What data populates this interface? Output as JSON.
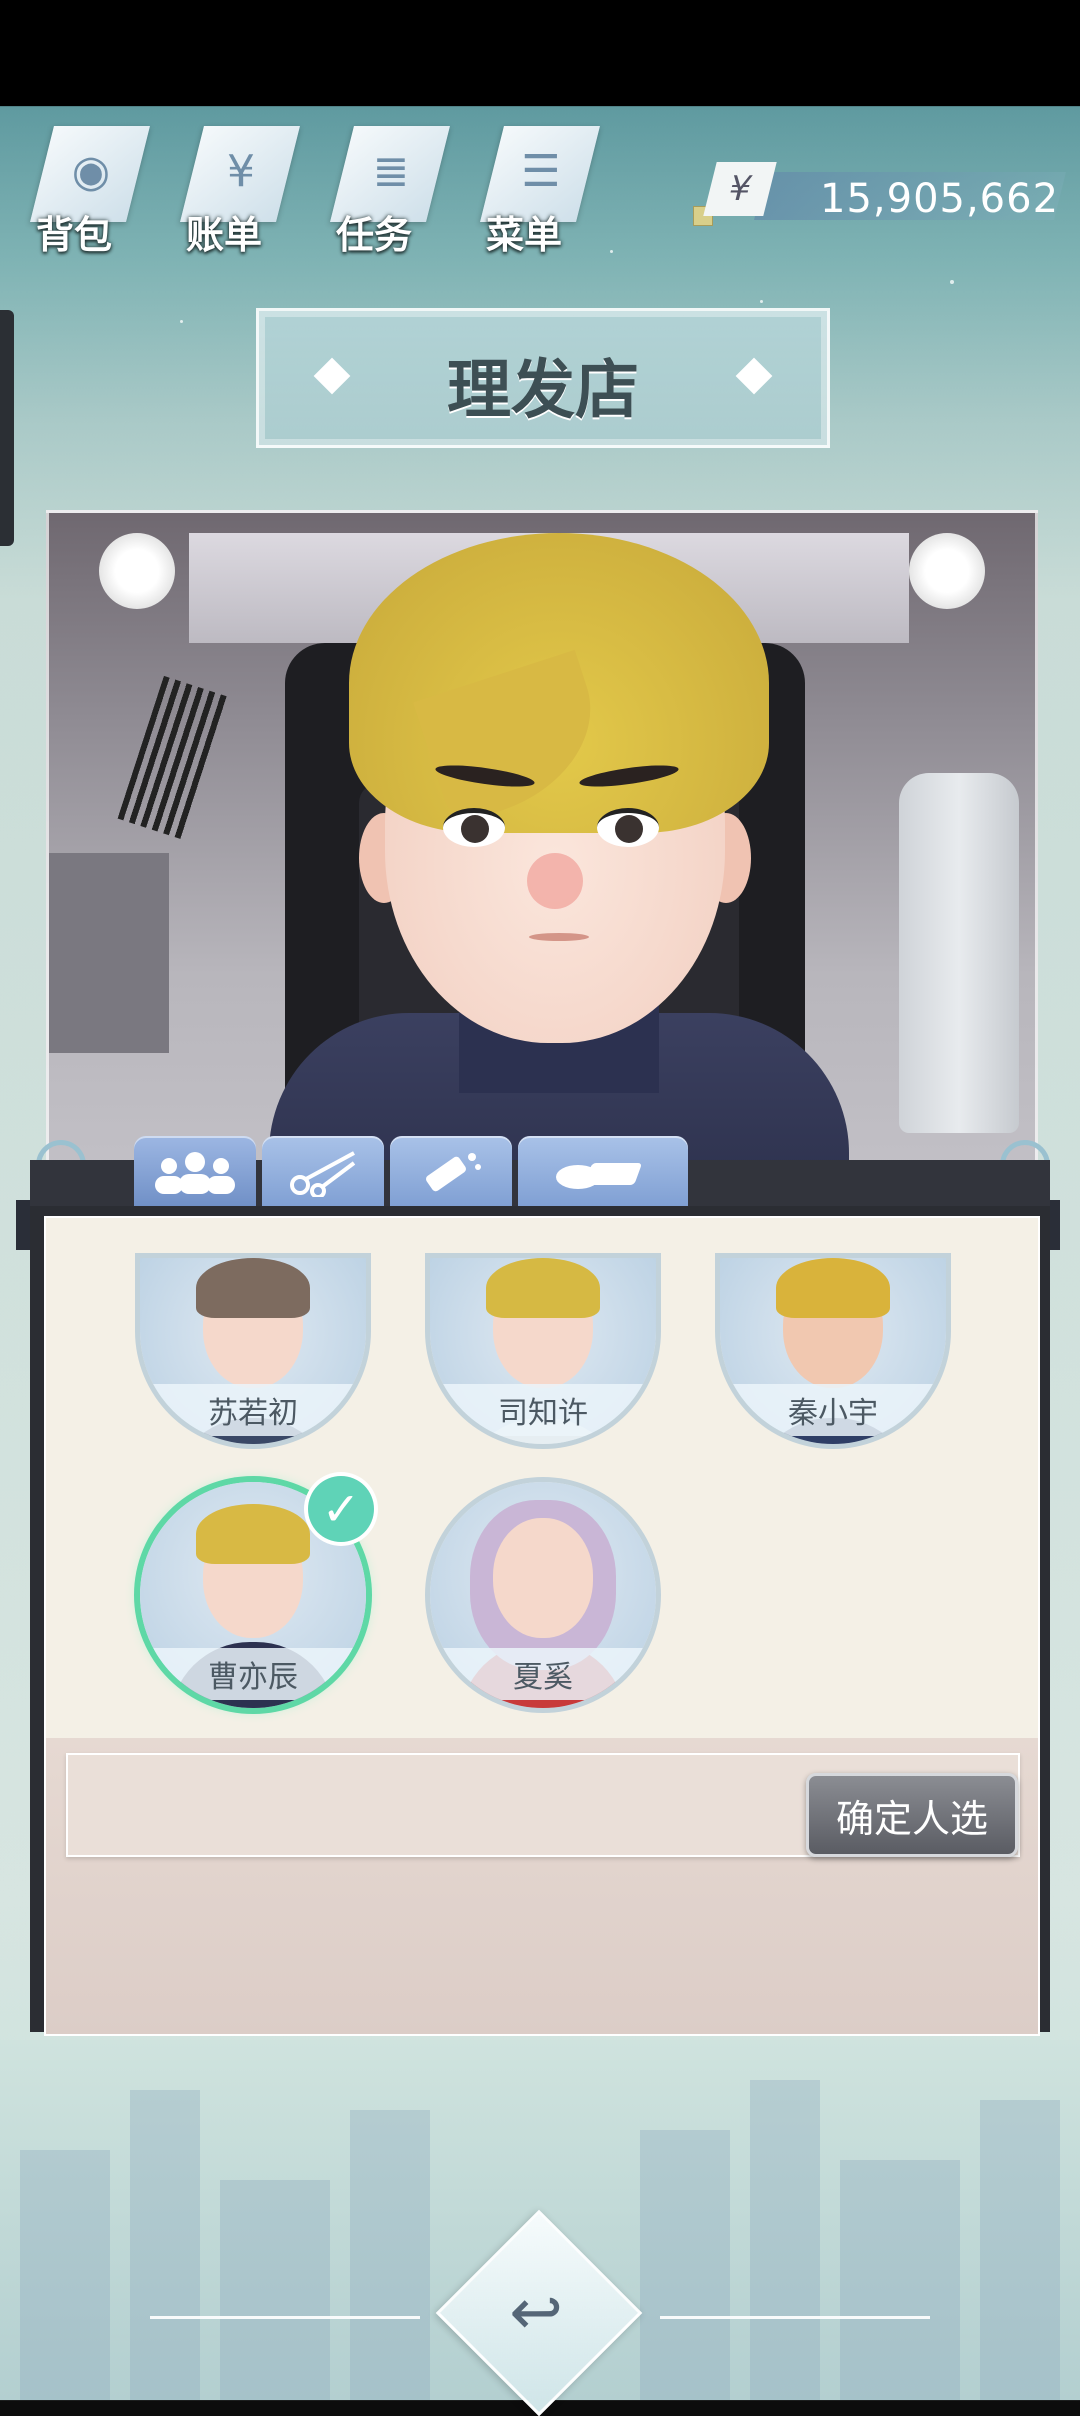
{
  "top_menu": [
    {
      "label": "背包",
      "icon": "backpack-icon"
    },
    {
      "label": "账单",
      "icon": "bill-icon"
    },
    {
      "label": "任务",
      "icon": "task-icon"
    },
    {
      "label": "菜单",
      "icon": "menu-icon"
    }
  ],
  "money": {
    "symbol": "¥",
    "value": "15,905,662"
  },
  "title": "理发店",
  "tabs": [
    {
      "icon": "people-icon"
    },
    {
      "icon": "scissors-icon"
    },
    {
      "icon": "spray-icon"
    },
    {
      "icon": "makeup-icon"
    }
  ],
  "characters": [
    {
      "name": "苏若初",
      "selected": false
    },
    {
      "name": "司知许",
      "selected": false
    },
    {
      "name": "秦小宇",
      "selected": false
    },
    {
      "name": "曹亦辰",
      "selected": true
    },
    {
      "name": "夏奚",
      "selected": false
    }
  ],
  "confirm_button": "确定人选",
  "colors": {
    "accent": "#5fd3b7",
    "tab": "#8aa8d9",
    "panel": "#f4f0e6"
  }
}
